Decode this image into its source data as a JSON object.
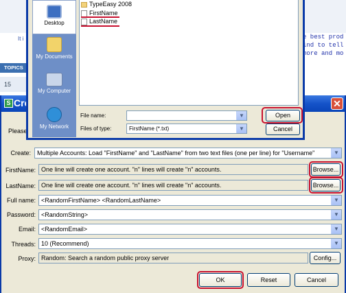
{
  "background_page": {
    "left_text": "It i",
    "right_lines": [
      "e best prod",
      "ind to tell",
      "more and mo"
    ],
    "topics_label": "TOPICS",
    "count": "15"
  },
  "main_dialog": {
    "title": "Cre",
    "close_glyph": "✕",
    "please_text": "Please",
    "rows": {
      "create": {
        "label": "Create:",
        "value": "Multiple Accounts: Load \"FirstName\" and \"LastName\" from two text files (one per line) for \"Username\""
      },
      "firstname": {
        "label": "FirstName:",
        "value": "One line will create one account. \"n\" lines will create \"n\" accounts.",
        "button": "Browse..."
      },
      "lastname": {
        "label": "LastName:",
        "value": "One line will create one account. \"n\" lines will create \"n\" accounts.",
        "button": "Browse..."
      },
      "fullname": {
        "label": "Full name:",
        "value": "<RandomFirstName> <RandomLastName>"
      },
      "password": {
        "label": "Password:",
        "value": "<RandomString>"
      },
      "email": {
        "label": "Email:",
        "value": "<RandomEmail>"
      },
      "threads": {
        "label": "Threads:",
        "value": "10 (Recommend)"
      },
      "proxy": {
        "label": "Proxy:",
        "value": "Random: Search a random public proxy server",
        "button": "Config..."
      }
    },
    "buttons": {
      "ok": "OK",
      "reset": "Reset",
      "cancel": "Cancel"
    }
  },
  "file_dialog": {
    "places": [
      {
        "label": "Desktop",
        "icon": "desktop-icon"
      },
      {
        "label": "My Documents",
        "icon": "my-documents-icon"
      },
      {
        "label": "My Computer",
        "icon": "my-computer-icon"
      },
      {
        "label": "My Network",
        "icon": "my-network-icon"
      }
    ],
    "files": [
      {
        "name": "TypeEasy 2008",
        "icon": "folder-icon"
      },
      {
        "name": "FirstName",
        "icon": "text-file-icon"
      },
      {
        "name": "LastName",
        "icon": "text-file-icon"
      }
    ],
    "file_name_label": "File name:",
    "file_name_value": "",
    "file_type_label": "Files of type:",
    "file_type_value": "FirstName (*.txt)",
    "open_button": "Open",
    "cancel_button": "Cancel"
  },
  "colors": {
    "highlight": "#c8102e",
    "titlebar": "#1553c9",
    "places_bar": "#6e8fc7"
  }
}
